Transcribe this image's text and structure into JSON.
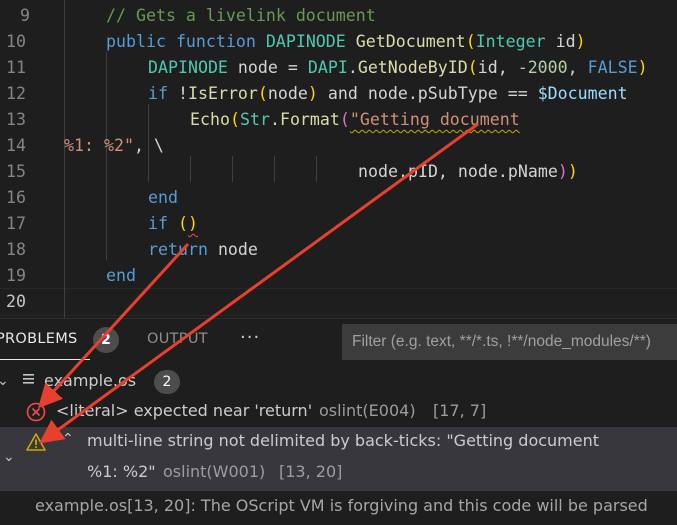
{
  "editor": {
    "lines": [
      {
        "num": "9",
        "tokens": [
          {
            "t": "// Gets a livelink document",
            "c": "c-comment"
          }
        ]
      },
      {
        "num": "10",
        "tokens": [
          {
            "t": "public ",
            "c": "c-kw"
          },
          {
            "t": "function ",
            "c": "c-kw"
          },
          {
            "t": "DAPINODE ",
            "c": "c-type"
          },
          {
            "t": "GetDocument",
            "c": "c-fn"
          },
          {
            "t": "(",
            "c": "c-paren"
          },
          {
            "t": "Integer ",
            "c": "c-type"
          },
          {
            "t": "id",
            "c": "c-plain"
          },
          {
            "t": ")",
            "c": "c-paren"
          }
        ]
      },
      {
        "num": "11",
        "tokens": [
          {
            "t": "DAPINODE ",
            "c": "c-type"
          },
          {
            "t": "node = ",
            "c": "c-plain"
          },
          {
            "t": "DAPI",
            "c": "c-type"
          },
          {
            "t": ".",
            "c": "c-plain"
          },
          {
            "t": "GetNodeByID",
            "c": "c-fn"
          },
          {
            "t": "(",
            "c": "c-paren"
          },
          {
            "t": "id, ",
            "c": "c-plain"
          },
          {
            "t": "-2000",
            "c": "c-num"
          },
          {
            "t": ", ",
            "c": "c-plain"
          },
          {
            "t": "FALSE",
            "c": "c-const"
          },
          {
            "t": ")",
            "c": "c-paren"
          }
        ]
      },
      {
        "num": "12",
        "tokens": [
          {
            "t": "if ",
            "c": "c-kw"
          },
          {
            "t": "!",
            "c": "c-plain"
          },
          {
            "t": "IsError",
            "c": "c-fn"
          },
          {
            "t": "(",
            "c": "c-paren"
          },
          {
            "t": "node",
            "c": "c-plain"
          },
          {
            "t": ")",
            "c": "c-paren"
          },
          {
            "t": " and ",
            "c": "c-plain"
          },
          {
            "t": "node",
            "c": "c-plain"
          },
          {
            "t": ".pSubType == ",
            "c": "c-plain"
          },
          {
            "t": "$Document",
            "c": "c-var"
          }
        ]
      },
      {
        "num": "13",
        "tokens": [
          {
            "t": "Echo",
            "c": "c-fn"
          },
          {
            "t": "(",
            "c": "c-paren"
          },
          {
            "t": "Str",
            "c": "c-type"
          },
          {
            "t": ".",
            "c": "c-plain"
          },
          {
            "t": "Format",
            "c": "c-fn"
          },
          {
            "t": "(",
            "c": "c-paren2"
          },
          {
            "t": "\"Getting document",
            "c": "c-str squig-warn"
          }
        ]
      },
      {
        "num": "14",
        "tokens": [
          {
            "t": "%1: %2\"",
            "c": "c-str"
          },
          {
            "t": ", \\",
            "c": "c-plain"
          }
        ]
      },
      {
        "num": "15",
        "tokens": [
          {
            "t": "node",
            "c": "c-plain"
          },
          {
            "t": ".pID, ",
            "c": "c-plain"
          },
          {
            "t": "node",
            "c": "c-plain"
          },
          {
            "t": ".pName",
            "c": "c-plain"
          },
          {
            "t": ")",
            "c": "c-paren2"
          },
          {
            "t": ")",
            "c": "c-paren"
          }
        ]
      },
      {
        "num": "16",
        "tokens": [
          {
            "t": "end",
            "c": "c-kw"
          }
        ]
      },
      {
        "num": "17",
        "tokens": [
          {
            "t": "if ",
            "c": "c-kw"
          },
          {
            "t": "(",
            "c": "c-paren"
          },
          {
            "t": ")",
            "c": "c-paren squig-err"
          }
        ]
      },
      {
        "num": "18",
        "tokens": [
          {
            "t": "return ",
            "c": "c-kw"
          },
          {
            "t": "node",
            "c": "c-plain"
          }
        ]
      },
      {
        "num": "19",
        "tokens": [
          {
            "t": "end",
            "c": "c-kw"
          }
        ]
      },
      {
        "num": "20",
        "tokens": []
      }
    ]
  },
  "panel": {
    "tabs": {
      "problems_label": "PROBLEMS",
      "problems_count": "2",
      "output_label": "OUTPUT",
      "more_label": "···"
    },
    "filter": {
      "placeholder": "Filter (e.g. text, **/*.ts, !**/node_modules/**)"
    },
    "file": {
      "name": "example.os",
      "count": "2"
    },
    "problems": [
      {
        "severity": "error",
        "message": "<literal> expected near 'return'",
        "source": "oslint(E004)",
        "position": "[17, 7]"
      },
      {
        "severity": "warning",
        "message_line1": "multi-line string not delimited by back-ticks: \"Getting document",
        "message_line2": "%1: %2\"",
        "source": "oslint(W001)",
        "position": "[13, 20]",
        "related": "example.os[13, 20]: The OScript VM is forgiving and this code will be parsed"
      }
    ]
  },
  "colors": {
    "error": "#f14c4c",
    "warning": "#cca700",
    "annotation_arrow": "#e8402f"
  }
}
